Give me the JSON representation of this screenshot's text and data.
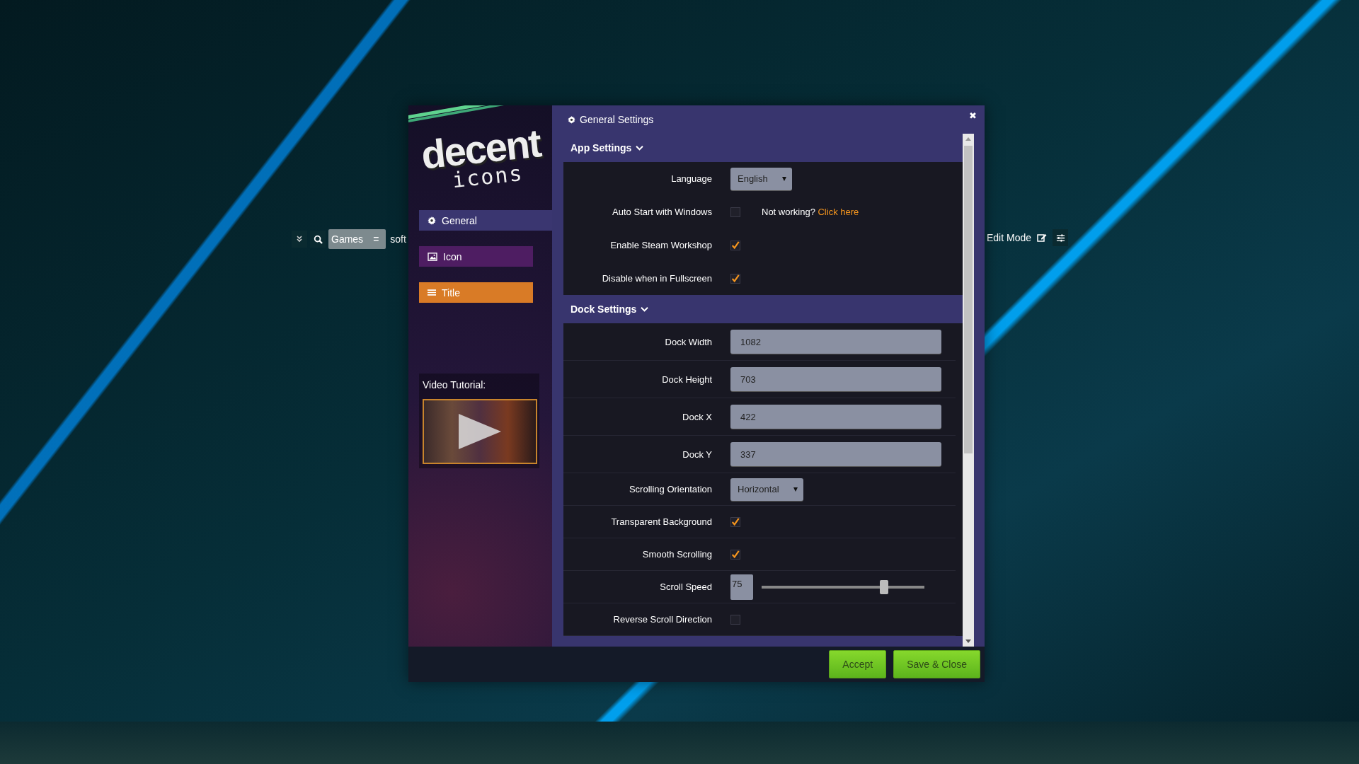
{
  "toolbar": {
    "left": {
      "chip": "Games",
      "chip_handle": "=",
      "cut_label": "soft"
    },
    "right": {
      "edit_mode": "Edit Mode"
    }
  },
  "window": {
    "title": "General Settings",
    "close": "✖"
  },
  "logo": {
    "line_1": "decent",
    "line_2": "icons"
  },
  "sidebar": {
    "items": [
      {
        "label": "General",
        "kind": "gear",
        "selected": true,
        "color": "#3a3670"
      },
      {
        "label": "Icon",
        "kind": "image",
        "selected": false,
        "color": "#4e1d62"
      },
      {
        "label": "Title",
        "kind": "list",
        "selected": false,
        "color": "#d97b26"
      }
    ],
    "video": {
      "label": "Video Tutorial:"
    }
  },
  "sections": [
    {
      "title": "App Settings",
      "expanded": true,
      "rows": [
        {
          "kind": "select",
          "label": "Language",
          "value": "English"
        },
        {
          "kind": "checkbox",
          "label": "Auto Start with Windows",
          "checked": false,
          "note": "Not working?",
          "link": "Click here"
        },
        {
          "kind": "checkbox",
          "label": "Enable Steam Workshop",
          "checked": true
        },
        {
          "kind": "checkbox",
          "label": "Disable when in Fullscreen",
          "checked": true
        }
      ]
    },
    {
      "title": "Dock Settings",
      "expanded": true,
      "rows": [
        {
          "kind": "text",
          "label": "Dock Width",
          "value": "1082"
        },
        {
          "kind": "text",
          "label": "Dock Height",
          "value": "703"
        },
        {
          "kind": "text",
          "label": "Dock X",
          "value": "422"
        },
        {
          "kind": "text",
          "label": "Dock Y",
          "value": "337"
        },
        {
          "kind": "select",
          "label": "Scrolling Orientation",
          "value": "Horizontal"
        },
        {
          "kind": "checkbox",
          "label": "Transparent Background",
          "checked": true
        },
        {
          "kind": "checkbox",
          "label": "Smooth Scrolling",
          "checked": true
        },
        {
          "kind": "slider",
          "label": "Scroll Speed",
          "value": "75",
          "level": 0.75
        },
        {
          "kind": "checkbox",
          "label": "Reverse Scroll Direction",
          "checked": false
        }
      ]
    }
  ],
  "buttons": [
    {
      "label": "Accept"
    },
    {
      "label": "Save & Close"
    }
  ]
}
